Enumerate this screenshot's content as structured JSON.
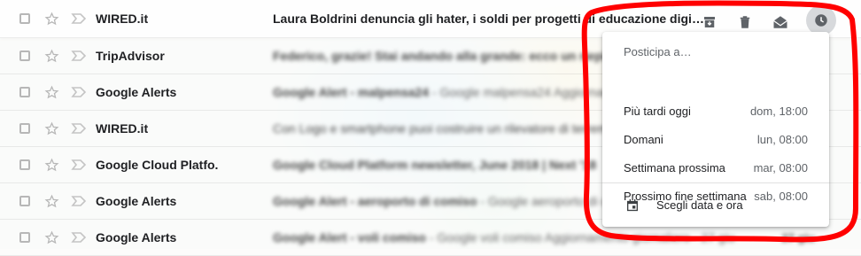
{
  "emails": [
    {
      "sender": "WIRED.it",
      "subject": "Laura Boldrini denuncia gli hater, i soldi per progetti di educazione digi…",
      "snippet": "",
      "date": "",
      "clear": true
    },
    {
      "sender": "TripAdvisor",
      "subject": "Federico, grazie! Stai andando alla grande: ecco un riepilogo",
      "snippet": "",
      "date": ""
    },
    {
      "sender": "Google Alerts",
      "subject": "Google Alert - malpensa24",
      "snippet": " - Google malpensa24 Aggiornamento giornaliero",
      "date": ""
    },
    {
      "sender": "WIRED.it",
      "subject": "Con Logo e smartphone puoi costruire un rilevatore di terremoti",
      "snippet": "",
      "date": ""
    },
    {
      "sender": "Google Cloud Platfo.",
      "subject": "Google Cloud Platform newsletter, June 2018 | Next '18",
      "snippet": "",
      "date": ""
    },
    {
      "sender": "Google Alerts",
      "subject": "Google Alert - aeroporto di comiso",
      "snippet": " - Google aeroporto di comiso Aggiornamento",
      "date": ""
    },
    {
      "sender": "Google Alerts",
      "subject": "Google Alert - voli comiso",
      "snippet": " - Google voli comiso Aggiornamento giornaliero · 27 giu",
      "date": "27 giu"
    }
  ],
  "row_actions": {
    "icons": [
      "archive-icon",
      "delete-icon",
      "mark-read-icon",
      "snooze-clock-icon"
    ]
  },
  "snooze_menu": {
    "title": "Posticipa a…",
    "options": [
      {
        "label": "Più tardi oggi",
        "when": "dom, 18:00"
      },
      {
        "label": "Domani",
        "when": "lun, 08:00"
      },
      {
        "label": "Settimana prossima",
        "when": "mar, 08:00"
      },
      {
        "label": "Prossimo fine settimana",
        "when": "sab, 08:00"
      }
    ],
    "custom_label": "Scegli data e ora"
  },
  "colors": {
    "annotation": "#ff0000",
    "snooze_hover": "#d7d9dc",
    "text": "#202124",
    "muted": "#5f6368"
  }
}
